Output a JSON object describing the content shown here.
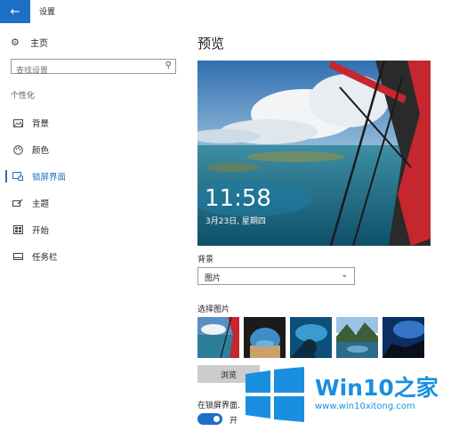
{
  "titlebar": {
    "back_icon": "back-arrow-icon",
    "title": "设置"
  },
  "nav": {
    "home": {
      "icon": "gear-icon",
      "label": "主页"
    },
    "search": {
      "placeholder": "查找设置",
      "icon": "search-icon"
    },
    "section": "个性化",
    "items": [
      {
        "icon": "picture-icon",
        "label": "背景",
        "active": false
      },
      {
        "icon": "palette-icon",
        "label": "颜色",
        "active": false
      },
      {
        "icon": "lock-screen-icon",
        "label": "锁屏界面",
        "active": true
      },
      {
        "icon": "theme-brush-icon",
        "label": "主题",
        "active": false
      },
      {
        "icon": "start-icon",
        "label": "开始",
        "active": false
      },
      {
        "icon": "taskbar-icon",
        "label": "任务栏",
        "active": false
      }
    ]
  },
  "main": {
    "preview_title": "预览",
    "clock": "11:58",
    "date": "3月23日, 星期四",
    "background_label": "背景",
    "background_value": "图片",
    "choose_label": "选择图片",
    "thumbnails": [
      "lock-photo-1",
      "lock-photo-2",
      "lock-photo-3",
      "lock-photo-4",
      "lock-photo-5"
    ],
    "browse_label": "浏览",
    "lock_text": "在锁屏界面.",
    "toggle_label": "开",
    "toggle_on": true
  },
  "watermark": {
    "title": "Win10",
    "title_zh": "之家",
    "url": "www.win10xitong.com"
  },
  "colors": {
    "accent": "#1e6fc6",
    "watermark": "#1a8fe0"
  }
}
